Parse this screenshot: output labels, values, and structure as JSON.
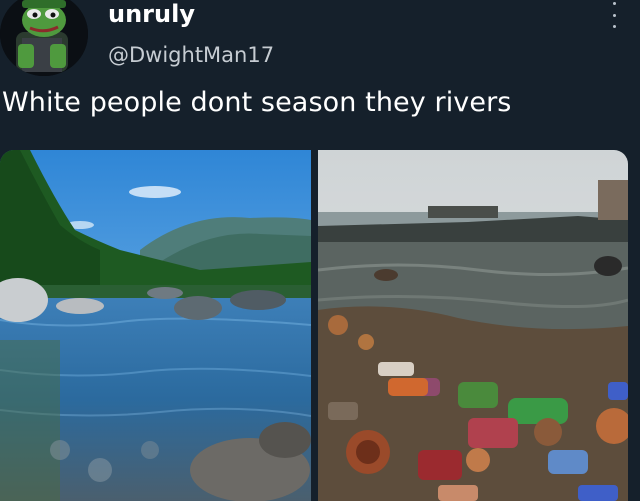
{
  "post": {
    "display_name": "unruly",
    "handle": "@DwightMan17",
    "text": "White people dont season they rivers"
  },
  "icons": {
    "avatar": "pepe-frog-avatar",
    "more": "more-options-icon"
  },
  "colors": {
    "background": "#15202b",
    "text_primary": "#ffffff",
    "text_secondary": "#c6ccd2"
  }
}
